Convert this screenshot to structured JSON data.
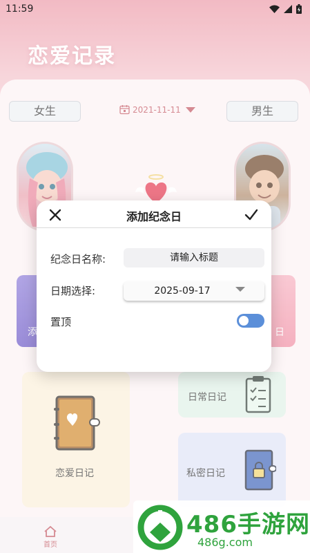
{
  "status_bar": {
    "time": "11:59"
  },
  "app": {
    "title": "恋爱记录",
    "female_button": "女生",
    "male_button": "男生",
    "date": "2021-11-11",
    "tiles": {
      "love_diary": "恋爱日记",
      "daily_diary": "日常日记",
      "private_diary": "私密日记"
    },
    "partial_left": "添",
    "partial_right": "日",
    "nav": {
      "home": "首页"
    }
  },
  "dialog": {
    "title": "添加纪念日",
    "name_label": "纪念日名称:",
    "name_placeholder": "请输入标题",
    "date_label": "日期选择:",
    "date_value": "2025-09-17",
    "pin_label": "置顶",
    "pin_enabled": true
  },
  "watermark": {
    "text": "486手游网",
    "sub": "486g.com"
  },
  "colors": {
    "toggle": "#5b8fd9",
    "accent": "#c2535f",
    "watermark": "#2fa33d"
  }
}
